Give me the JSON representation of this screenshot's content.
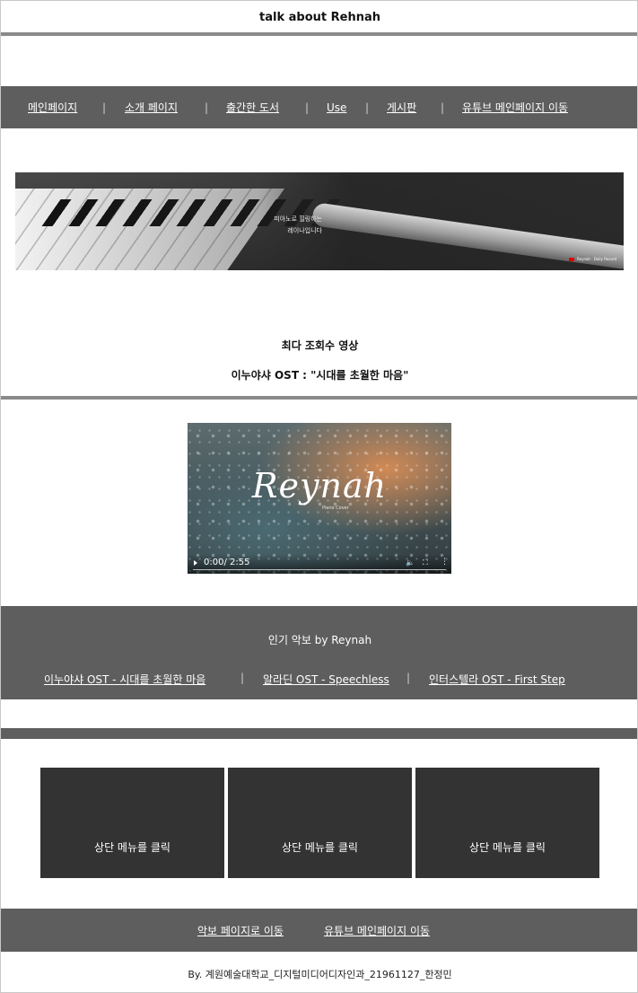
{
  "site": {
    "title": "talk about Rehnah"
  },
  "nav": {
    "items": [
      {
        "label": "메인페이지"
      },
      {
        "label": "소개 페이지 "
      },
      {
        "label": "출간한 도서"
      },
      {
        "label": "Use"
      },
      {
        "label": "게시판"
      },
      {
        "label": "유튜브 메인페이지 이동"
      }
    ],
    "separator": "|"
  },
  "banner": {
    "caption_line1": "피아노로 힐링하는",
    "caption_line2": "레이나입니다",
    "mark": "Reynah · Daily Record"
  },
  "featured": {
    "heading": "최다 조회수 영상",
    "video_title": "이누야샤 OST : \"시대를 초월한 마음\""
  },
  "video": {
    "logo": "Reynah",
    "subtitle": "Piano Cover",
    "time": "0:00/ 2:55",
    "icons": {
      "play": "play-icon",
      "volume": "volume-icon",
      "fullscreen": "fullscreen-icon",
      "more": "more-icon"
    }
  },
  "popular": {
    "title": "인기 악보 by Reynah",
    "links": [
      {
        "label": "이누야샤 OST - 시대를 초월한 마음"
      },
      {
        "label": "알라딘 OST - Speechless"
      },
      {
        "label": "인터스텔라 OST - First Step"
      }
    ],
    "separator": "|"
  },
  "cards": [
    {
      "label": "상단 메뉴를 클릭"
    },
    {
      "label": "상단 메뉴를 클릭"
    },
    {
      "label": "상단 메뉴를 클릭"
    }
  ],
  "footer": {
    "links": [
      {
        "label": "악보 페이지로 이동"
      },
      {
        "label": "유튜브 메인페이지 이동"
      }
    ],
    "credits": "By. 계원예술대학교_디지털미디어디자인과_21961127_한정민"
  },
  "colors": {
    "nav_background": "#5e5e5e",
    "card_background": "#333333",
    "rule": "#8a8a8a"
  }
}
